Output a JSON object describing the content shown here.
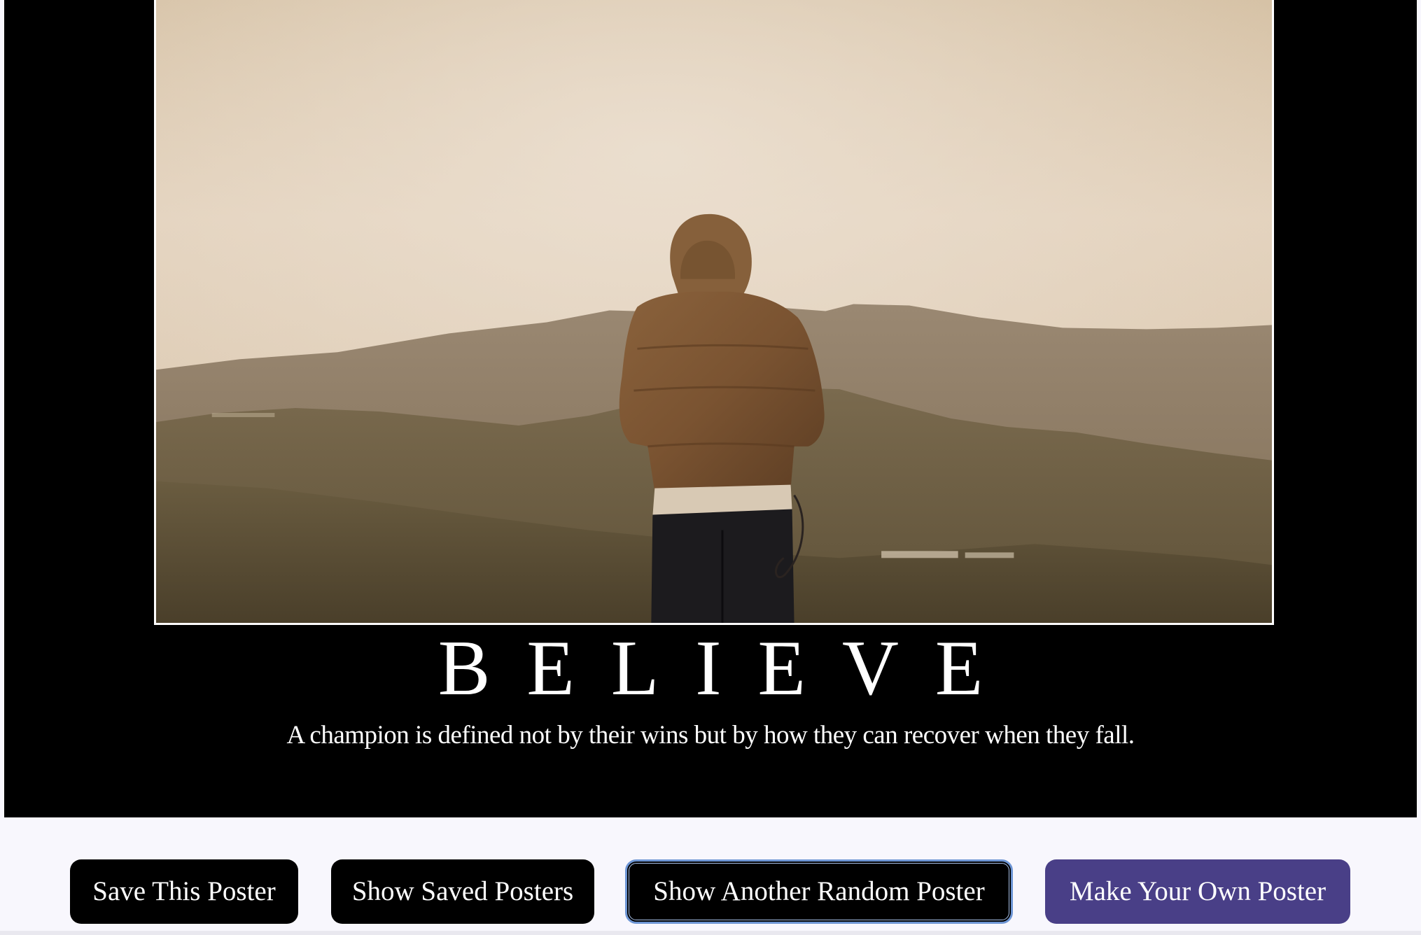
{
  "poster": {
    "title": "BELIEVE",
    "quote": "A champion is defined not by their wins but by how they can recover when they fall.",
    "image_subject": "hooded person looking at mountains"
  },
  "buttons": {
    "save": "Save This Poster",
    "show_saved": "Show Saved Posters",
    "random": "Show Another Random Poster",
    "make_own": "Make Your Own Poster"
  },
  "colors": {
    "poster_background": "#000000",
    "page_background": "#f8f7fd",
    "button_dark": "#000000",
    "button_accent": "#493f87",
    "focus_ring": "#6d95d4"
  }
}
